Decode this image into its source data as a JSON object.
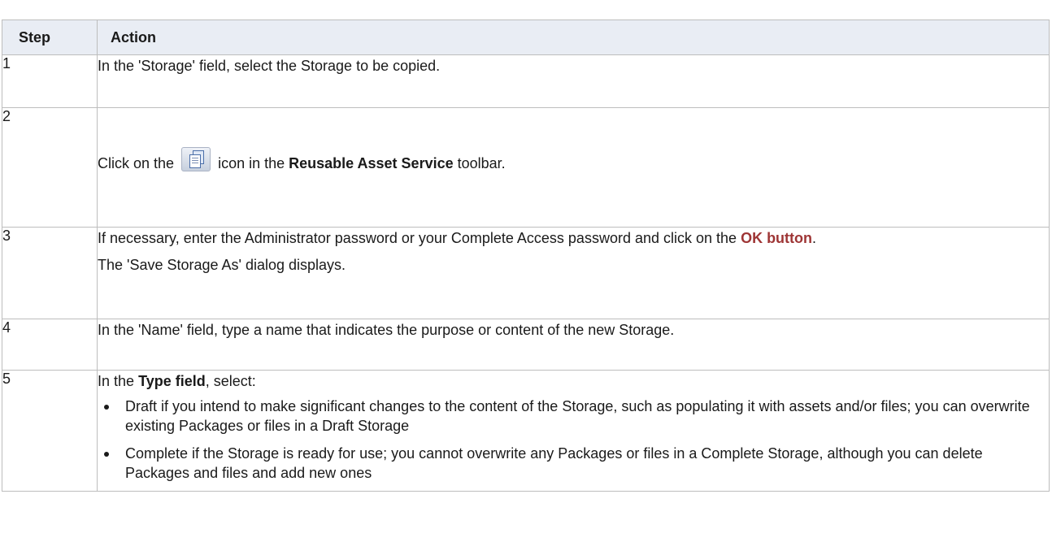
{
  "table": {
    "headers": {
      "step": "Step",
      "action": "Action"
    },
    "rows": [
      {
        "step": "1",
        "text": "In the 'Storage' field, select the Storage to be copied."
      },
      {
        "step": "2",
        "text_before": "Click on the",
        "icon": "copy-storage-icon",
        "text_middle": "icon in the",
        "bold": "Reusable Asset Service",
        "text_after": "toolbar."
      },
      {
        "step": "3",
        "text": "If necessary, enter the Administrator password or your Complete Access password and click on the",
        "link": "OK button",
        "text_end": ".",
        "note": "The 'Save Storage As' dialog displays."
      },
      {
        "step": "4",
        "text": "In the 'Name' field, type a name that indicates the purpose or content of the new Storage."
      },
      {
        "step": "5",
        "intro_before": "In the",
        "intro_bold": "Type field",
        "intro_after": ", select:",
        "bullets": [
          "Draft if you intend to make significant changes to the content of the Storage, such as populating it with assets and/or files; you can overwrite existing Packages or files in a Draft Storage",
          "Complete if the Storage is ready for use; you cannot overwrite any Packages or files in a Complete Storage, although you can delete Packages and files and add new ones"
        ]
      }
    ]
  },
  "colors": {
    "header_bg": "#e9edf4",
    "border": "#bdbdbd",
    "link": "#9e3535"
  }
}
